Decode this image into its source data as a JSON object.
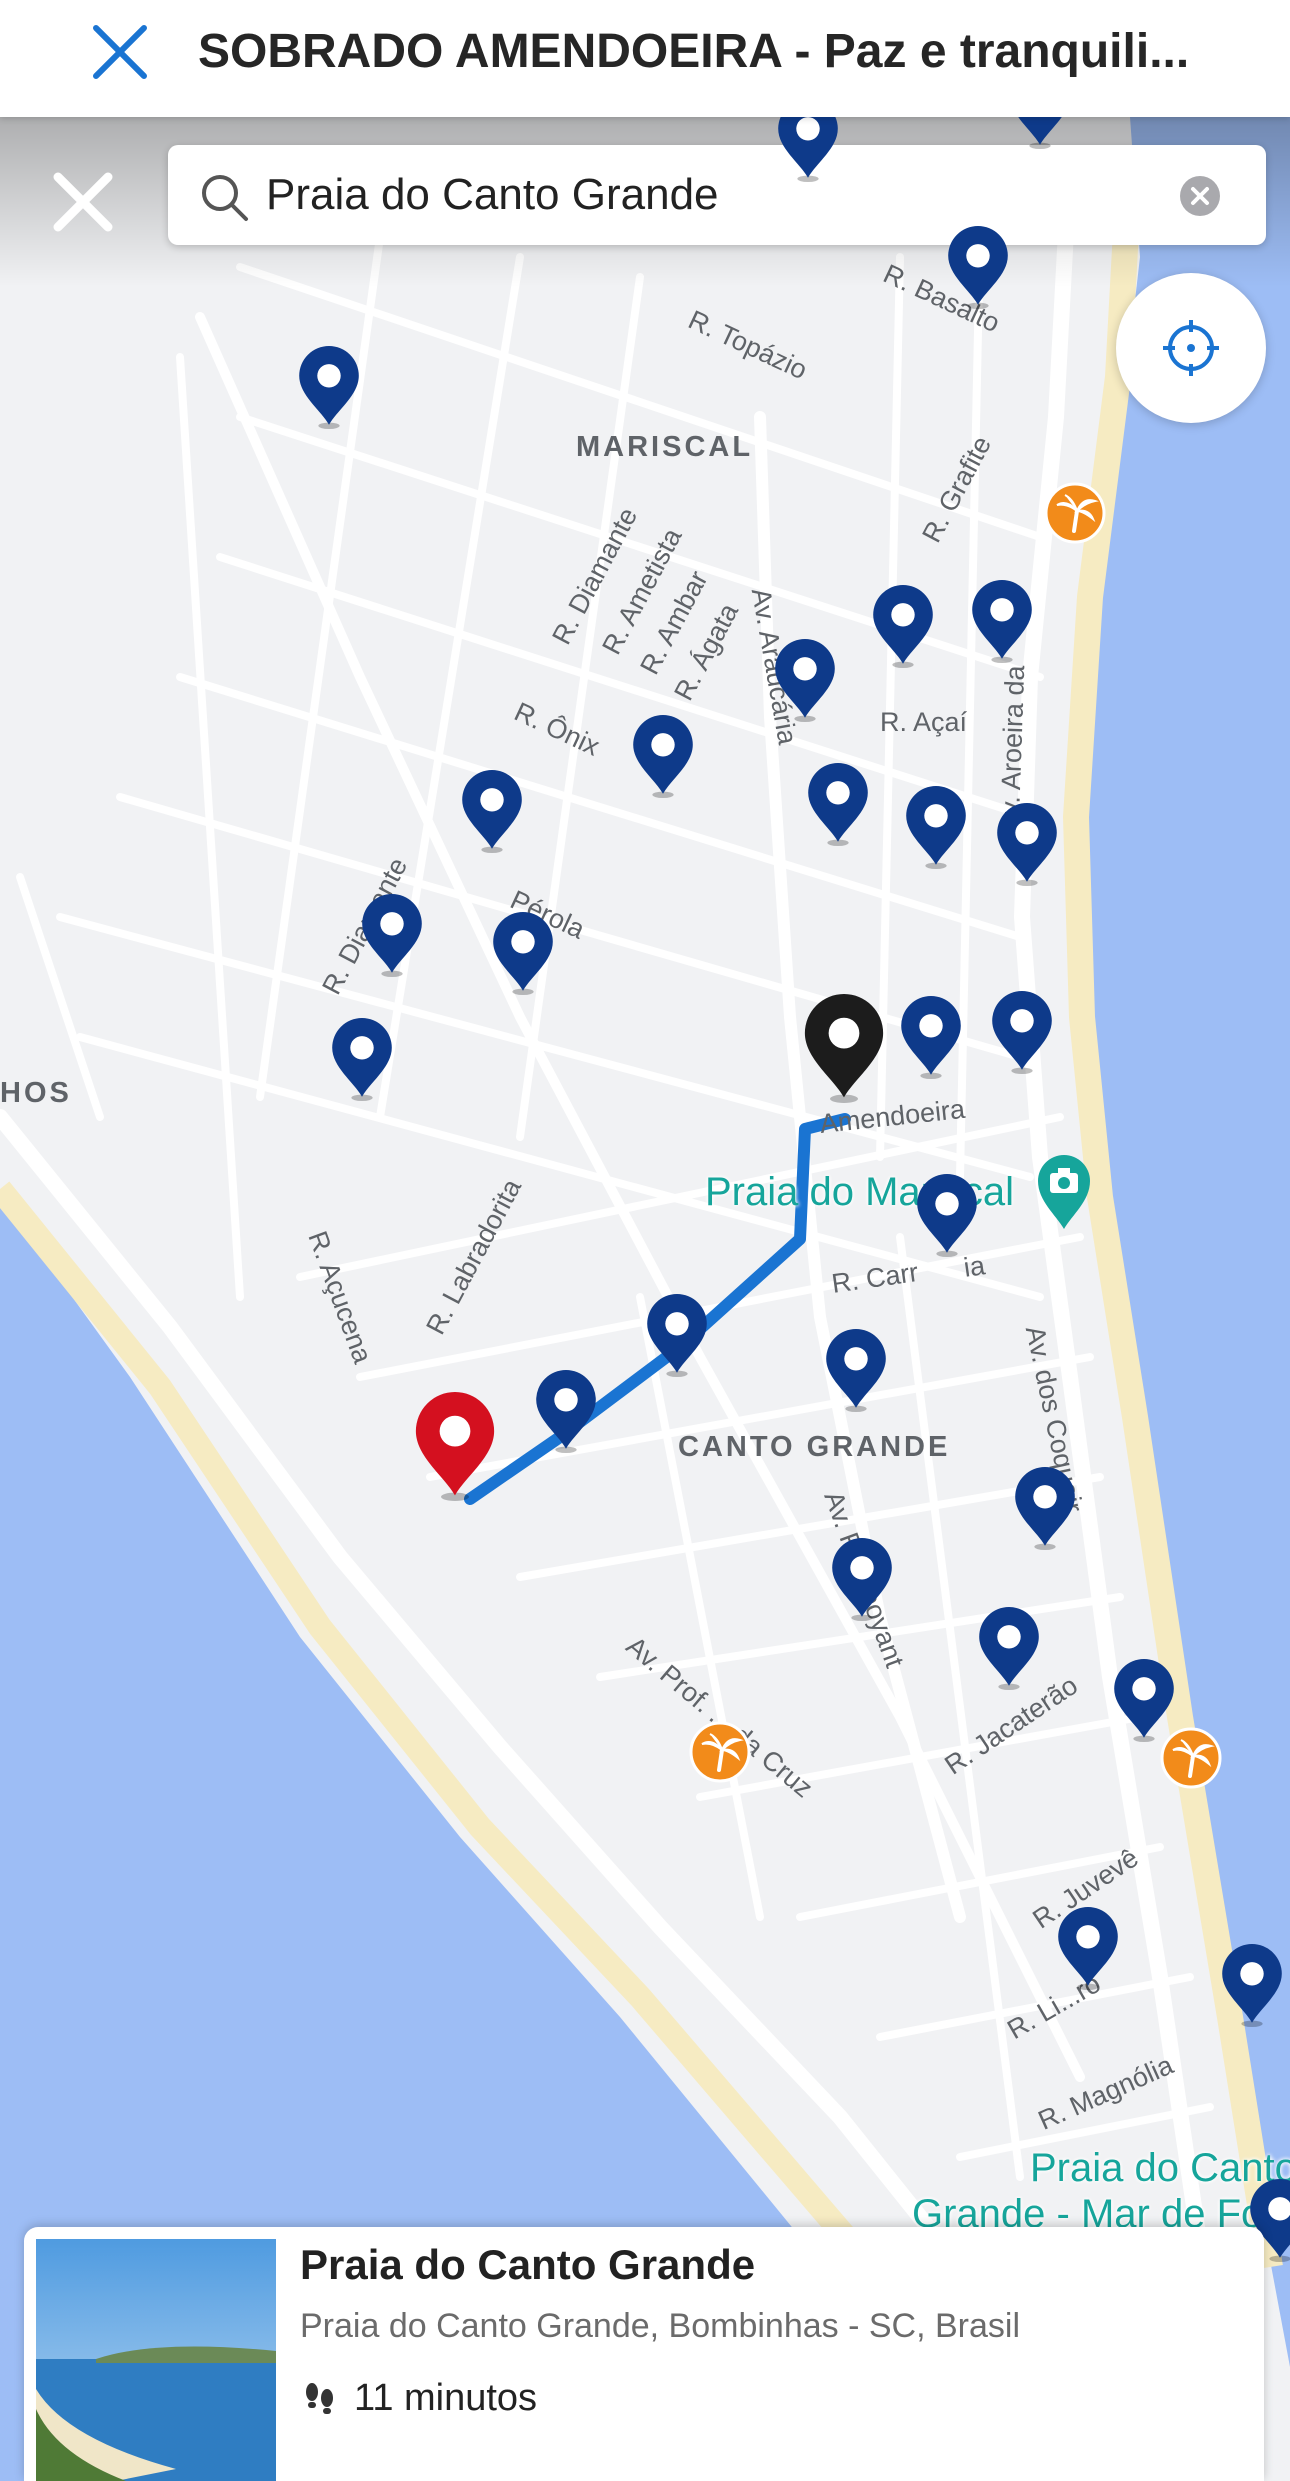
{
  "header": {
    "title": "SOBRADO AMENDOEIRA - Paz e tranquili..."
  },
  "search": {
    "value": "Praia do Canto Grande",
    "placeholder": "Praia do Canto Grande"
  },
  "map": {
    "area_labels": {
      "mariscal": "MARISCAL",
      "canto_grande": "CANTO GRANDE",
      "left_cut": "HOS"
    },
    "street_labels": {
      "topazio": "R. Topázio",
      "basalto": "R. Basalto",
      "grafite": "R. Grafite",
      "diamante_top": "R. Diamante",
      "ametista": "R. Ametista",
      "ambar": "R. Ambar",
      "agata": "R. Ágata",
      "araucaria": "Av. Araucária",
      "acai": "R. Açaí",
      "aroeira": "Av. Aroeira da",
      "onix": "R. Ônix",
      "perola": "Pérola",
      "diamante_left": "R. Diamante",
      "acucena": "R. Açucena",
      "labradorita": "R. Labradorita",
      "amendoeira": "Amendoeira",
      "carr": "R. Carr",
      "ia": "ia",
      "coqueiros": "Av. dos Coqueir",
      "flamboyant": "Av. Flamboyant",
      "cruz": "Av. Prof. ... da Cruz",
      "jacaterao": "R. Jacaterão",
      "juveve": "R. Juvevê",
      "li_ro": "R. Li...ro",
      "magnolia": "R. Magnólia"
    },
    "poi": {
      "mariscal": "Praia do Mariscal",
      "canto_line1": "Praia do Canto",
      "canto_line2": "Grande - Mar de Fo"
    },
    "colors": {
      "water": "#9dbdf5",
      "land": "#f1f2f4",
      "road": "#ffffff",
      "beach": "#f6ebc2",
      "route": "#1a74d2",
      "listing_pin": "#0e3a8a",
      "selected_pin": "#1c1c1c",
      "destination_pin": "#d4101f",
      "beach_icon": "#f28b1a",
      "poi_text": "#16a59b"
    },
    "icons": {
      "listing": "map-pin-icon",
      "beach": "palm-tree-icon",
      "poi": "camera-icon",
      "locate": "crosshair-icon"
    }
  },
  "result": {
    "name": "Praia do Canto Grande",
    "address": "Praia do Canto Grande, Bombinhas - SC, Brasil",
    "walk_time": "11 minutos"
  }
}
